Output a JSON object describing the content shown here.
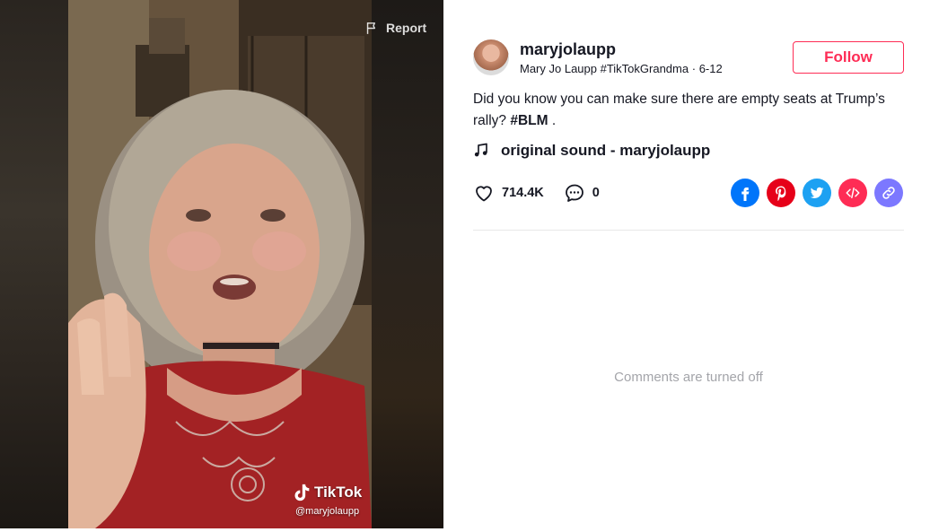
{
  "video": {
    "report_label": "Report",
    "watermark_brand": "TikTok",
    "watermark_handle": "@maryjolaupp"
  },
  "author": {
    "username": "maryjolaupp",
    "display_name": "Mary Jo Laupp #TikTokGrandma",
    "separator": "·",
    "date": "6-12"
  },
  "follow_label": "Follow",
  "caption": {
    "text": "Did you know you can make sure there are empty seats at Trump’s rally? ",
    "hashtag": "#BLM",
    "trailing": " ."
  },
  "music": {
    "title": "original sound - maryjolaupp",
    "icon": "music-note-icon"
  },
  "stats": {
    "likes": "714.4K",
    "comments": "0"
  },
  "share_targets": [
    {
      "name": "facebook",
      "icon": "facebook-icon",
      "color": "#0075fa"
    },
    {
      "name": "pinterest",
      "icon": "pinterest-icon",
      "color": "#e60019"
    },
    {
      "name": "twitter",
      "icon": "twitter-icon",
      "color": "#1da1f2"
    },
    {
      "name": "embed",
      "icon": "embed-code-icon",
      "color": "#fe2c55"
    },
    {
      "name": "copy-link",
      "icon": "link-icon",
      "color": "#7c78ff"
    }
  ],
  "comments_status": "Comments are turned off",
  "colors": {
    "accent": "#fe2c55",
    "text_primary": "#161823",
    "text_muted": "#a4a5aa"
  }
}
